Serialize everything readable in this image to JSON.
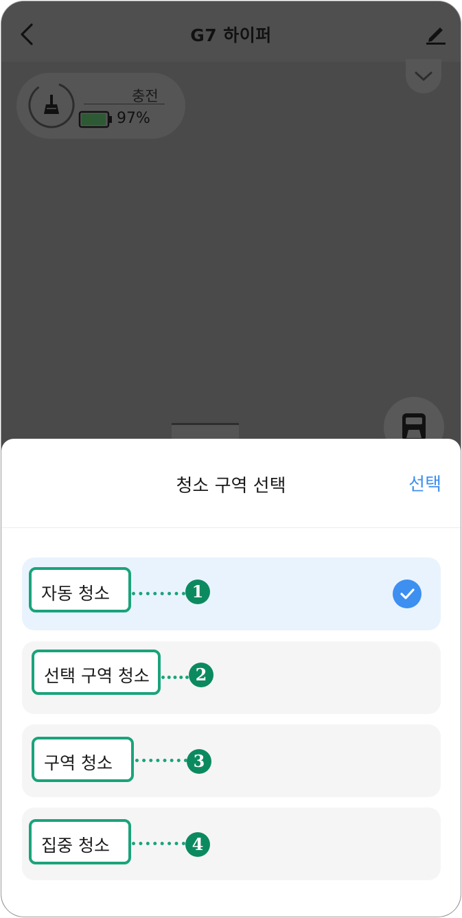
{
  "header": {
    "title": "G7 하이퍼",
    "back_icon": "chevron-left-icon",
    "edit_icon": "pencil-icon",
    "collapse_icon": "chevron-down-icon"
  },
  "status": {
    "label": "충전",
    "battery": "97%",
    "battery_level": 0.97,
    "robot_icon": "broom-icon",
    "battery_icon": "battery-icon"
  },
  "dock": {
    "icon": "docking-station-icon"
  },
  "sheet": {
    "title": "청소 구역 선택",
    "action": "선택",
    "options": [
      {
        "label": "자동 청소",
        "number": "1",
        "selected": true
      },
      {
        "label": "선택 구역 청소",
        "number": "2",
        "selected": false
      },
      {
        "label": "구역 청소",
        "number": "3",
        "selected": false
      },
      {
        "label": "집중 청소",
        "number": "4",
        "selected": false
      }
    ]
  },
  "colors": {
    "accent": "#3d8ff0",
    "annotation": "#1aa37a",
    "badge": "#0c8a5f",
    "selected_bg": "#e9f3fd",
    "option_bg": "#f5f5f5"
  }
}
